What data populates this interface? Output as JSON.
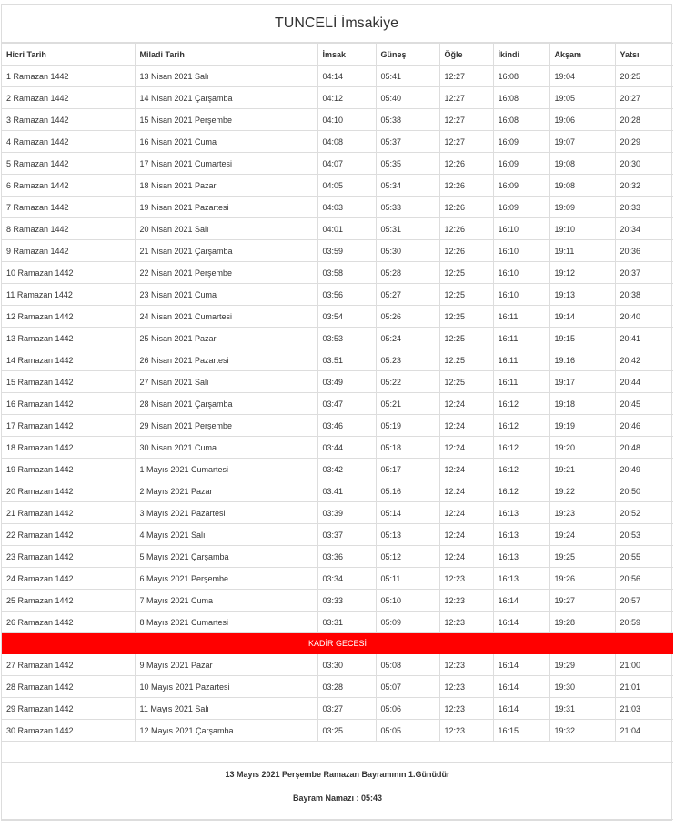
{
  "title": "TUNCELİ İmsakiye",
  "columns": [
    "Hicri Tarih",
    "Miladi Tarih",
    "İmsak",
    "Güneş",
    "Öğle",
    "İkindi",
    "Akşam",
    "Yatsı"
  ],
  "rows_before": [
    [
      "1 Ramazan 1442",
      "13 Nisan 2021 Salı",
      "04:14",
      "05:41",
      "12:27",
      "16:08",
      "19:04",
      "20:25"
    ],
    [
      "2 Ramazan 1442",
      "14 Nisan 2021 Çarşamba",
      "04:12",
      "05:40",
      "12:27",
      "16:08",
      "19:05",
      "20:27"
    ],
    [
      "3 Ramazan 1442",
      "15 Nisan 2021 Perşembe",
      "04:10",
      "05:38",
      "12:27",
      "16:08",
      "19:06",
      "20:28"
    ],
    [
      "4 Ramazan 1442",
      "16 Nisan 2021 Cuma",
      "04:08",
      "05:37",
      "12:27",
      "16:09",
      "19:07",
      "20:29"
    ],
    [
      "5 Ramazan 1442",
      "17 Nisan 2021 Cumartesi",
      "04:07",
      "05:35",
      "12:26",
      "16:09",
      "19:08",
      "20:30"
    ],
    [
      "6 Ramazan 1442",
      "18 Nisan 2021 Pazar",
      "04:05",
      "05:34",
      "12:26",
      "16:09",
      "19:08",
      "20:32"
    ],
    [
      "7 Ramazan 1442",
      "19 Nisan 2021 Pazartesi",
      "04:03",
      "05:33",
      "12:26",
      "16:09",
      "19:09",
      "20:33"
    ],
    [
      "8 Ramazan 1442",
      "20 Nisan 2021 Salı",
      "04:01",
      "05:31",
      "12:26",
      "16:10",
      "19:10",
      "20:34"
    ],
    [
      "9 Ramazan 1442",
      "21 Nisan 2021 Çarşamba",
      "03:59",
      "05:30",
      "12:26",
      "16:10",
      "19:11",
      "20:36"
    ],
    [
      "10 Ramazan 1442",
      "22 Nisan 2021 Perşembe",
      "03:58",
      "05:28",
      "12:25",
      "16:10",
      "19:12",
      "20:37"
    ],
    [
      "11 Ramazan 1442",
      "23 Nisan 2021 Cuma",
      "03:56",
      "05:27",
      "12:25",
      "16:10",
      "19:13",
      "20:38"
    ],
    [
      "12 Ramazan 1442",
      "24 Nisan 2021 Cumartesi",
      "03:54",
      "05:26",
      "12:25",
      "16:11",
      "19:14",
      "20:40"
    ],
    [
      "13 Ramazan 1442",
      "25 Nisan 2021 Pazar",
      "03:53",
      "05:24",
      "12:25",
      "16:11",
      "19:15",
      "20:41"
    ],
    [
      "14 Ramazan 1442",
      "26 Nisan 2021 Pazartesi",
      "03:51",
      "05:23",
      "12:25",
      "16:11",
      "19:16",
      "20:42"
    ],
    [
      "15 Ramazan 1442",
      "27 Nisan 2021 Salı",
      "03:49",
      "05:22",
      "12:25",
      "16:11",
      "19:17",
      "20:44"
    ],
    [
      "16 Ramazan 1442",
      "28 Nisan 2021 Çarşamba",
      "03:47",
      "05:21",
      "12:24",
      "16:12",
      "19:18",
      "20:45"
    ],
    [
      "17 Ramazan 1442",
      "29 Nisan 2021 Perşembe",
      "03:46",
      "05:19",
      "12:24",
      "16:12",
      "19:19",
      "20:46"
    ],
    [
      "18 Ramazan 1442",
      "30 Nisan 2021 Cuma",
      "03:44",
      "05:18",
      "12:24",
      "16:12",
      "19:20",
      "20:48"
    ],
    [
      "19 Ramazan 1442",
      "1 Mayıs 2021 Cumartesi",
      "03:42",
      "05:17",
      "12:24",
      "16:12",
      "19:21",
      "20:49"
    ],
    [
      "20 Ramazan 1442",
      "2 Mayıs 2021 Pazar",
      "03:41",
      "05:16",
      "12:24",
      "16:12",
      "19:22",
      "20:50"
    ],
    [
      "21 Ramazan 1442",
      "3 Mayıs 2021 Pazartesi",
      "03:39",
      "05:14",
      "12:24",
      "16:13",
      "19:23",
      "20:52"
    ],
    [
      "22 Ramazan 1442",
      "4 Mayıs 2021 Salı",
      "03:37",
      "05:13",
      "12:24",
      "16:13",
      "19:24",
      "20:53"
    ],
    [
      "23 Ramazan 1442",
      "5 Mayıs 2021 Çarşamba",
      "03:36",
      "05:12",
      "12:24",
      "16:13",
      "19:25",
      "20:55"
    ],
    [
      "24 Ramazan 1442",
      "6 Mayıs 2021 Perşembe",
      "03:34",
      "05:11",
      "12:23",
      "16:13",
      "19:26",
      "20:56"
    ],
    [
      "25 Ramazan 1442",
      "7 Mayıs 2021 Cuma",
      "03:33",
      "05:10",
      "12:23",
      "16:14",
      "19:27",
      "20:57"
    ],
    [
      "26 Ramazan 1442",
      "8 Mayıs 2021 Cumartesi",
      "03:31",
      "05:09",
      "12:23",
      "16:14",
      "19:28",
      "20:59"
    ]
  ],
  "kadir_label": "KADİR GECESİ",
  "kadir_color": "#ff0000",
  "rows_after": [
    [
      "27 Ramazan 1442",
      "9 Mayıs 2021 Pazar",
      "03:30",
      "05:08",
      "12:23",
      "16:14",
      "19:29",
      "21:00"
    ],
    [
      "28 Ramazan 1442",
      "10 Mayıs 2021 Pazartesi",
      "03:28",
      "05:07",
      "12:23",
      "16:14",
      "19:30",
      "21:01"
    ],
    [
      "29 Ramazan 1442",
      "11 Mayıs 2021 Salı",
      "03:27",
      "05:06",
      "12:23",
      "16:14",
      "19:31",
      "21:03"
    ],
    [
      "30 Ramazan 1442",
      "12 Mayıs 2021 Çarşamba",
      "03:25",
      "05:05",
      "12:23",
      "16:15",
      "19:32",
      "21:04"
    ]
  ],
  "footer": {
    "bayram_note": "13 Mayıs 2021 Perşembe Ramazan Bayramının 1.Günüdür",
    "bayram_prayer": "Bayram Namazı : 05:43"
  }
}
